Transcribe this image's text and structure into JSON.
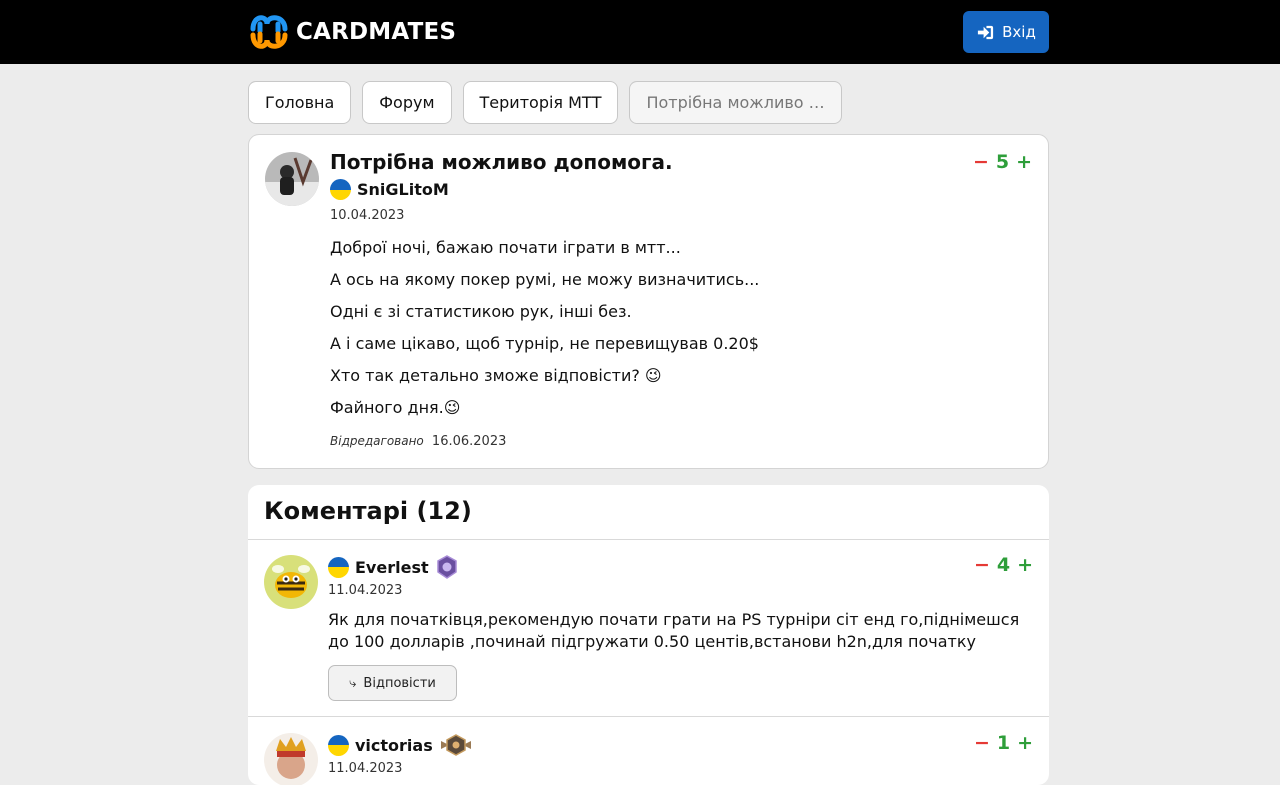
{
  "header": {
    "logo_text": "CARDMATES",
    "login_label": "Вхід"
  },
  "breadcrumbs": [
    {
      "label": "Головна"
    },
    {
      "label": "Форум"
    },
    {
      "label": "Територія МТТ"
    },
    {
      "label": "Потрібна можливо д..."
    }
  ],
  "post": {
    "title": "Потрібна можливо допомога.",
    "author": "SniGLitoM",
    "author_flag": "ukraine-flag-icon",
    "date": "10.04.2023",
    "score": "5",
    "minus": "−",
    "plus": "+",
    "body": [
      "Доброї ночі, бажаю почати іграти в мтт...",
      "А ось на якому покер румі, не можу визначитись...",
      "Одні є зі статистикою рук, інші без.",
      "А і саме цікаво, щоб турнір, не перевищував 0.20$",
      "Хто так детально зможе відповісти? 😉",
      "Файного дня.😉"
    ],
    "edited_label": "Відредаговано",
    "edited_date": "16.06.2023"
  },
  "comments": {
    "title": "Коментарі (12)",
    "items": [
      {
        "author": "Everlest",
        "date": "11.04.2023",
        "score": "4",
        "text": "Як для початківця,рекомендую почати грати на PS турніри сіт енд го,піднімешся до 100 долларів ,починай підгружати 0.50 центів,встанови h2n,для початку",
        "reply_label": "Відповісти",
        "badge": "purple-rank-badge-icon"
      },
      {
        "author": "victorias",
        "date": "11.04.2023",
        "score": "1",
        "badge": "bronze-rank-badge-icon"
      }
    ]
  },
  "colors": {
    "accent": "#1565c0",
    "vote_minus": "#e53935",
    "vote_plus": "#2e9e3a"
  }
}
